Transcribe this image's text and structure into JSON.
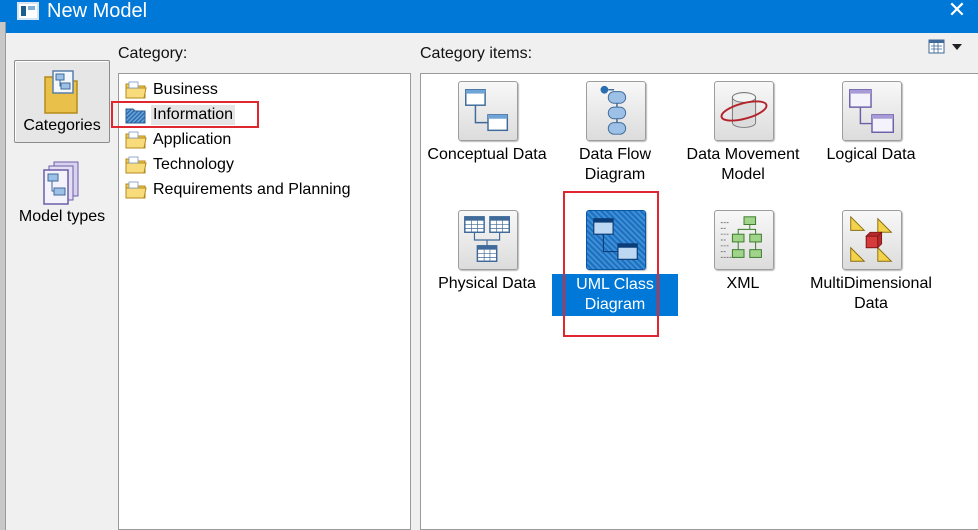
{
  "window": {
    "title": "New Model"
  },
  "nav": [
    {
      "label": "Categories",
      "icon": "categories-icon",
      "selected": true
    },
    {
      "label": "Model types",
      "icon": "model-types-icon",
      "selected": false
    }
  ],
  "category": {
    "label": "Category:",
    "items": [
      {
        "label": "Business",
        "icon": "folder-icon"
      },
      {
        "label": "Information",
        "icon": "folder-icon",
        "selected": true
      },
      {
        "label": "Application",
        "icon": "folder-icon"
      },
      {
        "label": "Technology",
        "icon": "folder-icon"
      },
      {
        "label": "Requirements and Planning",
        "icon": "folder-icon"
      }
    ]
  },
  "items_panel": {
    "label": "Category items:",
    "view_icon": "list-view-icon",
    "tiles": [
      {
        "label": "Conceptual Data",
        "icon": "conceptual-data-icon"
      },
      {
        "label": "Data Flow Diagram",
        "icon": "data-flow-diagram-icon"
      },
      {
        "label": "Data Movement Model",
        "icon": "data-movement-model-icon"
      },
      {
        "label": "Logical Data",
        "icon": "logical-data-icon"
      },
      {
        "label": "Physical Data",
        "icon": "physical-data-icon"
      },
      {
        "label": "UML Class Diagram",
        "icon": "uml-class-diagram-icon",
        "selected": true
      },
      {
        "label": "XML",
        "icon": "xml-icon"
      },
      {
        "label": "MultiDimensional Data",
        "icon": "multidimensional-data-icon"
      }
    ]
  },
  "colors": {
    "titlebar": "#0078d7",
    "highlight_box": "#e0262e",
    "selection": "#0078d7"
  }
}
